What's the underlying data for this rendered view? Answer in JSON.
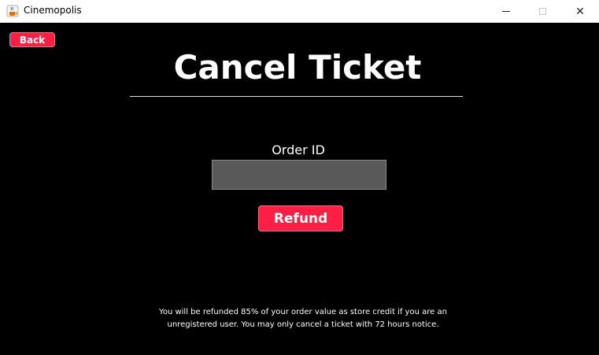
{
  "window": {
    "title": "Cinemopolis",
    "icon": "java-cup-icon",
    "close_glyph": "✕"
  },
  "page": {
    "back_label": "Back",
    "title": "Cancel Ticket",
    "order_id_label": "Order ID",
    "order_id_value": "",
    "refund_label": "Refund",
    "notice_line1": "You will be refunded 85% of your order value as store credit if you are an",
    "notice_line2": "unregistered user. You may only cancel a ticket with 72 hours notice."
  },
  "colors": {
    "background": "#000000",
    "accent": "#ff1f44",
    "input_bg": "#595959",
    "text": "#ffffff"
  }
}
